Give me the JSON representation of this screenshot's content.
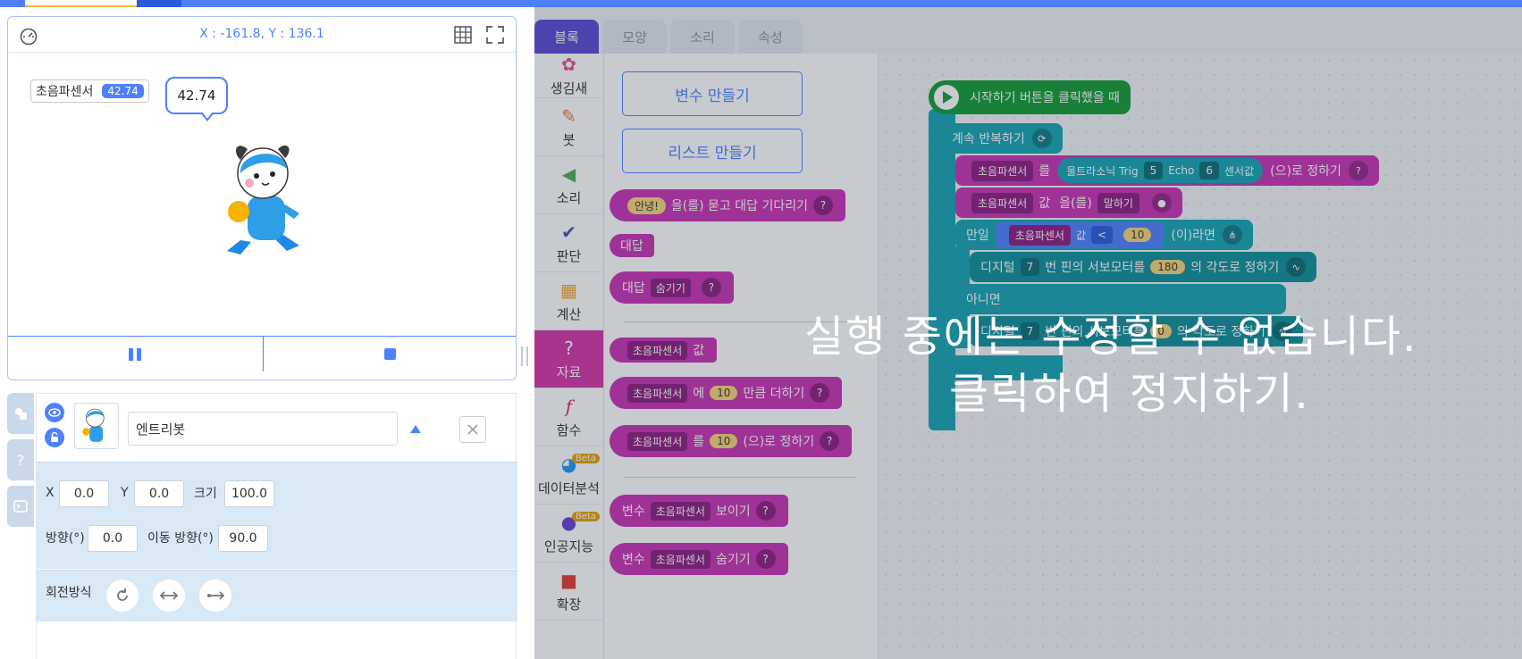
{
  "stage": {
    "coords": "X : -161.8, Y : 136.1",
    "variable_monitor": {
      "name": "초음파센서",
      "value": "42.74"
    },
    "speech_bubble": "42.74",
    "icons": {
      "speed": "gauge-icon",
      "grid": "grid-icon",
      "fullscreen": "fullscreen-icon",
      "pause": "pause-icon",
      "stop": "stop-icon"
    }
  },
  "sprite_panel": {
    "object_name": "엔트리봇",
    "x_label": "X",
    "x_value": "0.0",
    "y_label": "Y",
    "y_value": "0.0",
    "size_label": "크기",
    "size_value": "100.0",
    "direction_label": "방향(°)",
    "direction_value": "0.0",
    "move_direction_label": "이동 방향(°)",
    "move_direction_value": "90.0",
    "rotation_label": "회전방식"
  },
  "tabs": [
    "블록",
    "모양",
    "소리",
    "속성"
  ],
  "categories": [
    {
      "label": "생김새",
      "icon": "looks-icon"
    },
    {
      "label": "붓",
      "icon": "brush-icon"
    },
    {
      "label": "소리",
      "icon": "speaker-icon"
    },
    {
      "label": "판단",
      "icon": "check-icon"
    },
    {
      "label": "계산",
      "icon": "calculator-icon"
    },
    {
      "label": "자료",
      "icon": "question-icon"
    },
    {
      "label": "함수",
      "icon": "function-icon"
    },
    {
      "label": "데이터분석",
      "icon": "pie-chart-icon",
      "badge": "Beta"
    },
    {
      "label": "인공지능",
      "icon": "ai-icon",
      "badge": "Beta"
    },
    {
      "label": "확장",
      "icon": "truck-icon"
    }
  ],
  "palette": {
    "make_variable": "변수 만들기",
    "make_list": "리스트 만들기",
    "ask_default": "안녕!",
    "ask_text": "을(를) 묻고 대답 기다리기",
    "answer": "대답",
    "answer_label": "대답",
    "hide": "숨기기",
    "var_name": "초음파센서",
    "value": "값",
    "add_to": "에",
    "ten": "10",
    "add_suffix": "만큼 더하기",
    "set_mid": "를",
    "set_suffix": "(으)로 정하기",
    "var_word": "변수",
    "show": "보이기",
    "hint": "?"
  },
  "code": {
    "when_start": "시작하기 버튼을 클릭했을 때",
    "forever": "계속 반복하기",
    "var_name": "초음파센서",
    "set_to_mid": "를",
    "ultrasonic": "울트라소닉 Trig",
    "trig": "5",
    "echo_label": "Echo",
    "echo": "6",
    "sensor_value": "센서값",
    "set_suffix": "(으)로 정하기",
    "value": "값",
    "say_mid": "을(를)",
    "say": "말하기",
    "if_label": "만일",
    "lt": "<",
    "threshold": "10",
    "if_suffix": "(이)라면",
    "digital": "디지털",
    "pin": "7",
    "servo_text": "번 핀의 서보모터를",
    "angle_1": "180",
    "angle_suffix": "의 각도로 정하기",
    "else": "아니면",
    "angle_2": "0",
    "hint": "?"
  },
  "overlay": {
    "line1": "실행 중에는 수정할 수 없습니다.",
    "line2": "클릭하여 정지하기."
  },
  "colors": {
    "accent": "#4f80ff",
    "data_category": "#d635a8",
    "arduino_block": "#16a4b3",
    "start_block": "#159b35",
    "blocks_tab": "#5a4ad4"
  }
}
